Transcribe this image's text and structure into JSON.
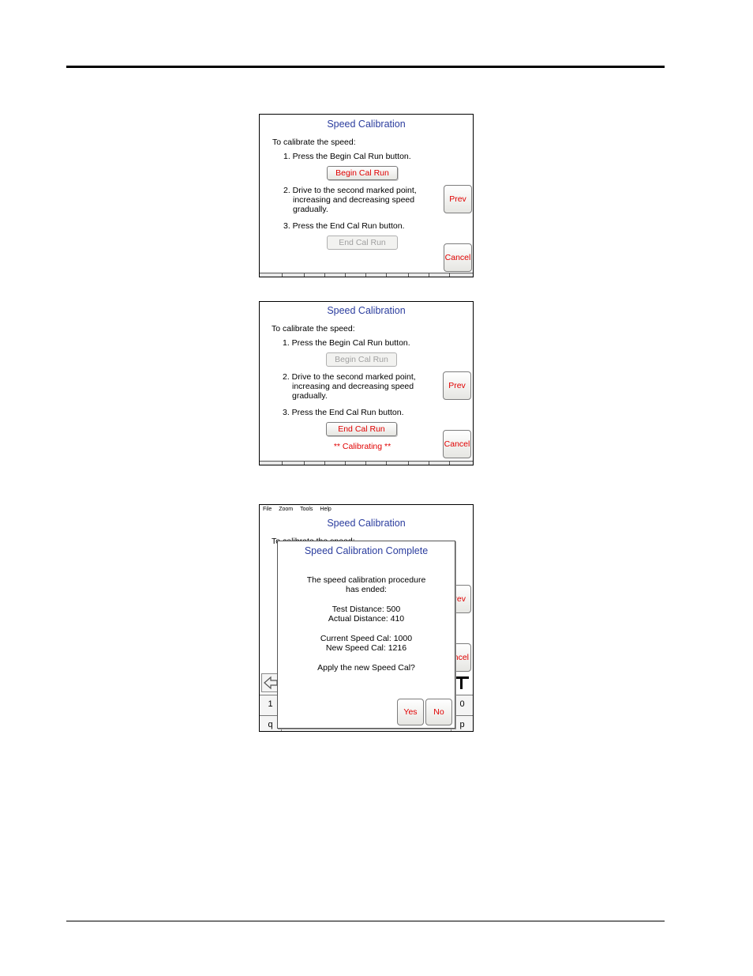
{
  "screen1": {
    "title": "Speed Calibration",
    "intro": "To calibrate the speed:",
    "step1": "1. Press the Begin Cal Run button.",
    "begin_button": "Begin Cal Run",
    "step2_line1": "2. Drive to the second marked point,",
    "step2_line2": "increasing and decreasing speed",
    "step2_line3": "gradually.",
    "step3": "3. Press the End Cal Run button.",
    "end_button": "End Cal Run",
    "prev_button": "Prev",
    "cancel_button": "Cancel"
  },
  "screen2": {
    "title": "Speed Calibration",
    "intro": "To calibrate the speed:",
    "step1": "1. Press the Begin Cal Run button.",
    "begin_button": "Begin Cal Run",
    "step2_line1": "2. Drive to the second marked point,",
    "step2_line2": "increasing and decreasing speed",
    "step2_line3": "gradually.",
    "step3": "3. Press the End Cal Run button.",
    "end_button": "End Cal Run",
    "status": "** Calibrating **",
    "prev_button": "Prev",
    "cancel_button": "Cancel"
  },
  "screen3": {
    "menu": [
      "File",
      "Zoom",
      "Tools",
      "Help"
    ],
    "title": "Speed Calibration",
    "intro_partial": "To calibrate the speed:",
    "prev_partial": "rev",
    "cancel_partial": "ncel",
    "keys_row1": [
      "1",
      "0"
    ],
    "keys_row2": [
      "q",
      "p"
    ],
    "dialog": {
      "title": "Speed Calibration Complete",
      "line1": "The speed calibration procedure",
      "line2": "has ended:",
      "test_distance": "Test Distance:  500",
      "actual_distance": "Actual Distance: 410",
      "current_cal": "Current Speed Cal: 1000",
      "new_cal": "New Speed Cal:  1216",
      "question": "Apply the new Speed Cal?",
      "yes_button": "Yes",
      "no_button": "No"
    }
  }
}
